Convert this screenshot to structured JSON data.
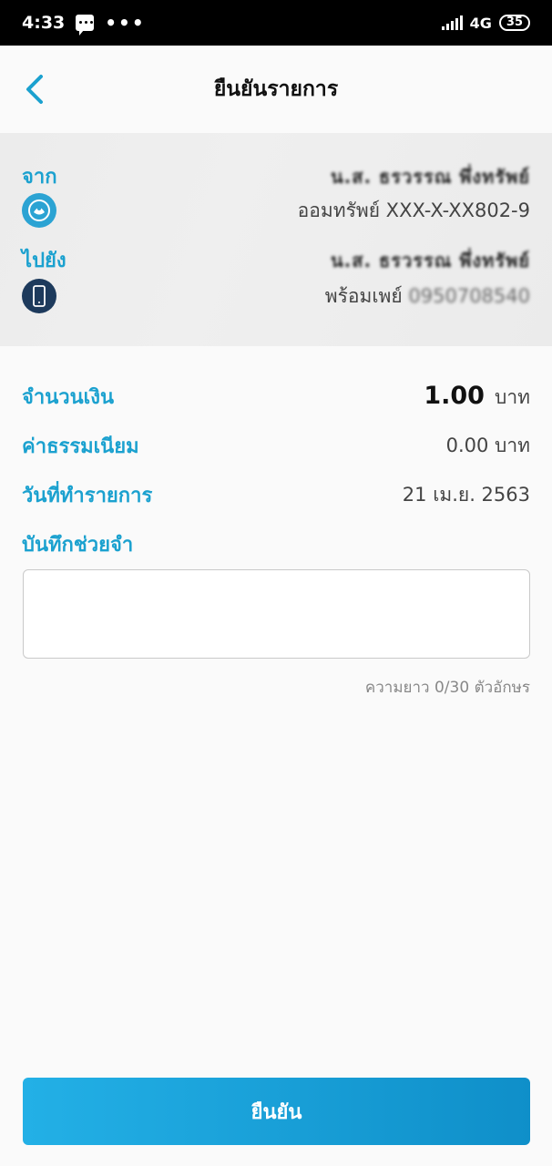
{
  "status_bar": {
    "time": "4:33",
    "more": "•••",
    "network": "4G",
    "battery": "35"
  },
  "header": {
    "title": "ยืนยันรายการ"
  },
  "from": {
    "label": "จาก",
    "name": "น.ส. ธรวรรณ พึ่งทรัพย์",
    "account": "ออมทรัพย์ XXX-X-XX802-9"
  },
  "to": {
    "label": "ไปยัง",
    "name": "น.ส. ธรวรรณ พึ่งทรัพย์",
    "account_prefix": "พร้อมเพย์",
    "account_number": "0950708540"
  },
  "details": {
    "amount_label": "จำนวนเงิน",
    "amount_value": "1.00",
    "amount_unit": "บาท",
    "fee_label": "ค่าธรรมเนียม",
    "fee_value": "0.00 บาท",
    "date_label": "วันที่ทำรายการ",
    "date_value": "21 เม.ย. 2563",
    "memo_label": "บันทึกช่วยจำ",
    "memo_value": "",
    "memo_count": "ความยาว 0/30 ตัวอักษร"
  },
  "confirm_button": {
    "label": "ยืนยัน"
  },
  "colors": {
    "accent": "#1ba1cf",
    "button": "#1599d6",
    "panel": "#ededed"
  }
}
